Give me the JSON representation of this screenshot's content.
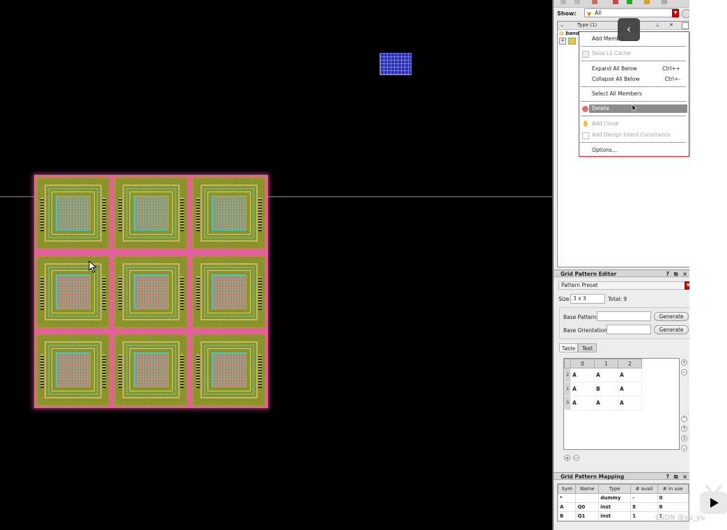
{
  "colors": {
    "array_border": "#e2609c",
    "cell_fill": "#8f9a2c",
    "menu_border": "#c0383f",
    "dropdown_red": "#c00000"
  },
  "filter": {
    "label": "Show:",
    "value": "All"
  },
  "tree": {
    "header_type": "Type (1)",
    "row_label": "band"
  },
  "context_menu": {
    "items": [
      {
        "label": "Add Member",
        "shortcut": ""
      },
      {
        "label": "Save L1 Cache",
        "shortcut": ""
      },
      {
        "label": "Expand All Below",
        "shortcut": "Ctrl++"
      },
      {
        "label": "Collapse All Below",
        "shortcut": "Ctrl+-"
      },
      {
        "label": "Select All Members",
        "shortcut": ""
      },
      {
        "label": "Delete",
        "shortcut": ""
      },
      {
        "label": "Add Clone",
        "shortcut": ""
      },
      {
        "label": "Add Design Intent Constraints",
        "shortcut": ""
      },
      {
        "label": "Options...",
        "shortcut": ""
      }
    ]
  },
  "grid_editor": {
    "title": "Grid Pattern Editor",
    "controls": "? ⧉ ×",
    "preset": "Pattern Preset",
    "size_label": "Size",
    "size_value": "3 x 3",
    "total": "Total: 9",
    "base_pattern_label": "Base Pattern",
    "base_orientation_label": "Base Orientation",
    "generate": "Generate",
    "tabs": [
      "Table",
      "Text"
    ],
    "col_headers": [
      "0",
      "1",
      "2"
    ],
    "rows": [
      {
        "index": "2",
        "cells": [
          "A",
          "A",
          "A"
        ]
      },
      {
        "index": "1",
        "cells": [
          "A",
          "B",
          "A"
        ]
      },
      {
        "index": "0",
        "cells": [
          "A",
          "A",
          "A"
        ]
      }
    ]
  },
  "grid_mapping": {
    "title": "Grid Pattern Mapping",
    "controls": "? ⧉ ×",
    "headers": [
      "Sym",
      "Name",
      "Type",
      "# avail",
      "# in use"
    ],
    "rows": [
      [
        "*",
        "",
        "dummy",
        "-",
        "0"
      ],
      [
        "A",
        "Q0",
        "inst",
        "8",
        "8"
      ],
      [
        "B",
        "Q1",
        "inst",
        "1",
        "1"
      ]
    ]
  },
  "watermark": "CSDN @yu_yu"
}
